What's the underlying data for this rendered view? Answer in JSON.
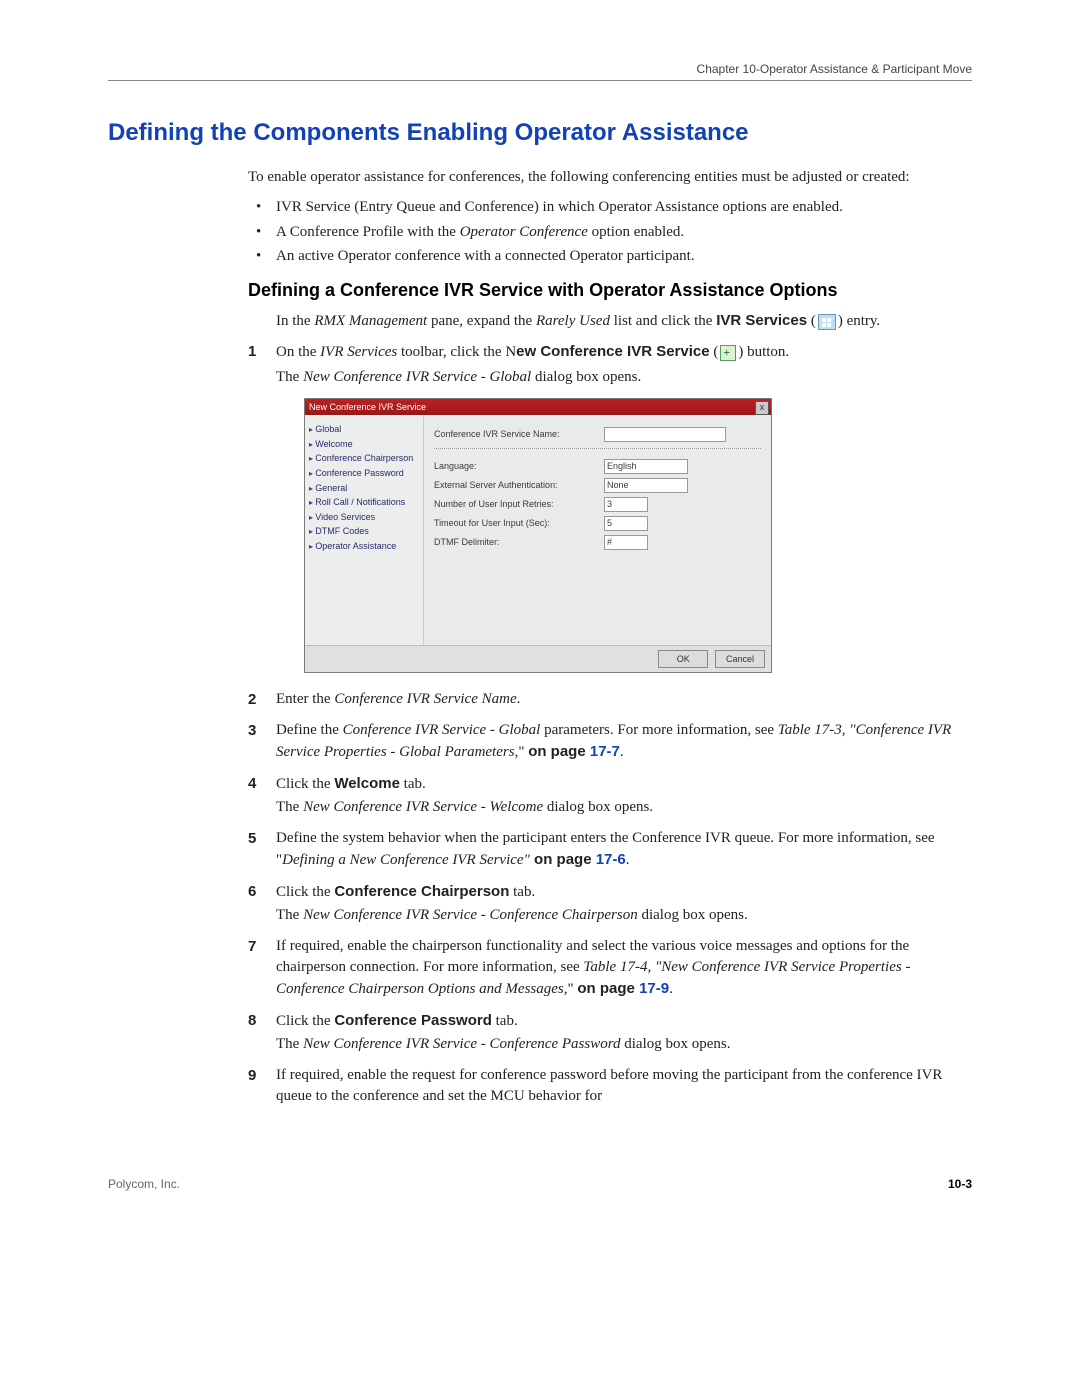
{
  "running_head": "Chapter 10-Operator Assistance & Participant Move",
  "h1": "Defining the Components Enabling Operator Assistance",
  "intro": "To enable operator assistance for conferences, the following conferencing entities must be adjusted or created:",
  "bullets": {
    "b1": "IVR Service (Entry Queue and Conference) in which Operator Assistance options are enabled.",
    "b2_a": "A Conference Profile with the ",
    "b2_i": "Operator Conference",
    "b2_b": " option enabled.",
    "b3": "An active Operator conference with a connected Operator participant."
  },
  "h2": "Defining a Conference IVR Service with Operator Assistance Options",
  "lead": {
    "a": "In the ",
    "i1": "RMX Management",
    "b": " pane, expand the ",
    "i2": "Rarely Used",
    "c": " list and click the ",
    "bold": "IVR Services",
    "d": " (",
    "e": ") entry."
  },
  "steps": {
    "s1": {
      "a": "On the ",
      "i1": "IVR Services",
      "b": " toolbar, click the N",
      "bold": "ew Conference IVR Service",
      "c": " (",
      "d": ") button.",
      "line2a": "The ",
      "line2i": "New Conference IVR Service - Global",
      "line2b": " dialog box opens."
    },
    "s2": {
      "a": "Enter the ",
      "i": "Conference IVR Service Name",
      "b": "."
    },
    "s3": {
      "a": "Define the ",
      "i1": "Conference IVR Service - Global",
      "b": " parameters. For more information, see ",
      "i2": "Table 17-3, \"Conference IVR Service Properties - Global Parameters",
      "c": ",\" ",
      "bold_on": "on page ",
      "xref": "17-7",
      "d": "."
    },
    "s4": {
      "a": "Click the ",
      "bold": "Welcome",
      "b": " tab.",
      "line2a": "The ",
      "line2i": "New Conference IVR Service - Welcome",
      "line2b": " dialog box opens."
    },
    "s5": {
      "a": "Define the system behavior when the participant enters the Conference IVR queue. For more information, see \"",
      "i": "Defining a New Conference IVR Service\"",
      "b": " on page ",
      "xref": "17-6",
      "c": "."
    },
    "s6": {
      "a": "Click the ",
      "bold": "Conference Chairperson",
      "b": " tab.",
      "line2a": "The ",
      "line2i": "New Conference IVR Service - Conference Chairperson",
      "line2b": " dialog box opens."
    },
    "s7": {
      "a": "If required, enable the chairperson functionality and select the various voice messages and options for the chairperson connection. For more information, see ",
      "i": "Table 17-4, \"New Conference IVR Service Properties - Conference Chairperson Options and Messages",
      "b": ",\" ",
      "bold_on": "on page ",
      "xref": "17-9",
      "c": "."
    },
    "s8": {
      "a": "Click the ",
      "bold": "Conference Password",
      "b": " tab.",
      "line2a": "The ",
      "line2i": "New Conference IVR Service - Conference Password",
      "line2b": " dialog box opens."
    },
    "s9": {
      "a": "If required, enable the request for conference password before moving the participant from the conference IVR queue to the conference and set the MCU behavior for"
    }
  },
  "dialog": {
    "title": "New Conference IVR Service",
    "close": "x",
    "nav": {
      "0": "Global",
      "1": "Welcome",
      "2": "Conference Chairperson",
      "3": "Conference Password",
      "4": "General",
      "5": "Roll Call / Notifications",
      "6": "Video Services",
      "7": "DTMF Codes",
      "8": "Operator Assistance"
    },
    "fields": {
      "name_label": "Conference IVR Service Name:",
      "lang_label": "Language:",
      "lang_val": "English",
      "ext_label": "External Server Authentication:",
      "ext_val": "None",
      "retries_label": "Number of User Input Retries:",
      "retries_val": "3",
      "timeout_label": "Timeout for User Input (Sec):",
      "timeout_val": "5",
      "delim_label": "DTMF Delimiter:",
      "delim_val": "#"
    },
    "ok": "OK",
    "cancel": "Cancel"
  },
  "footer": {
    "left": "Polycom, Inc.",
    "right": "10-3"
  }
}
